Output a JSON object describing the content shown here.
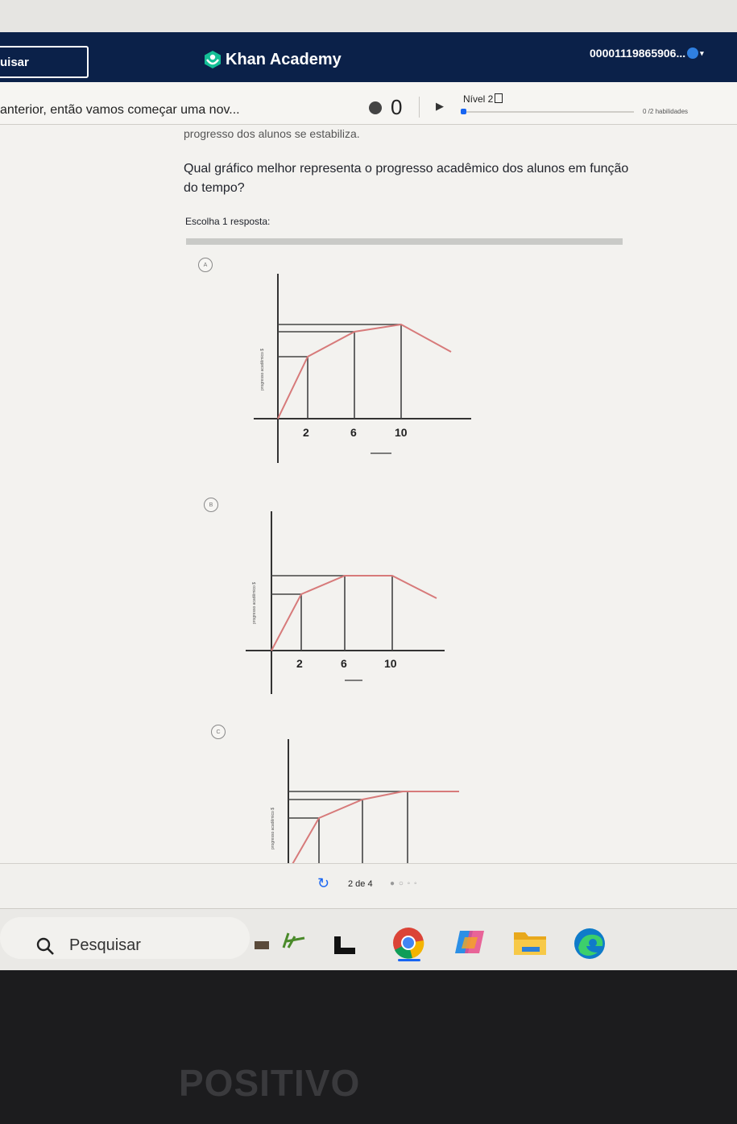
{
  "header": {
    "search_label": "uisar",
    "brand_name": "Khan Academy",
    "user_id": "00001119865906..."
  },
  "exercise": {
    "title": "anterior, então vamos começar uma nov...",
    "streak_count": "0",
    "level_label": "Nível 2",
    "skills_label": "0 /2 habilidades",
    "progress_fraction": 0.02
  },
  "content": {
    "cut_text": "progresso dos alunos se estabiliza.",
    "question": "Qual gráfico melhor representa o progresso acadêmico dos alunos em função do tempo?",
    "choose_label": "Escolha 1 resposta:",
    "options": [
      {
        "letter": "A",
        "ticks": [
          "2",
          "6",
          "10"
        ],
        "ylabel": "progresso acadêmico $"
      },
      {
        "letter": "B",
        "ticks": [
          "2",
          "6",
          "10"
        ],
        "ylabel": "progresso acadêmico $"
      },
      {
        "letter": "C",
        "ticks": [],
        "ylabel": "progresso acadêmico $"
      }
    ]
  },
  "footer": {
    "pager": "2 de 4",
    "dots": "● ○ ◦ ◦"
  },
  "taskbar": {
    "search_placeholder": "Pesquisar",
    "icons": [
      "search-icon",
      "widgets-icon",
      "task-view-icon",
      "chrome-icon",
      "copilot-icon",
      "file-explorer-icon",
      "edge-icon"
    ]
  },
  "device": {
    "brand": "POSITIVO"
  },
  "colors": {
    "header_bg": "#0b2149",
    "curve": "#d77a7a",
    "accent": "#1865f2"
  }
}
